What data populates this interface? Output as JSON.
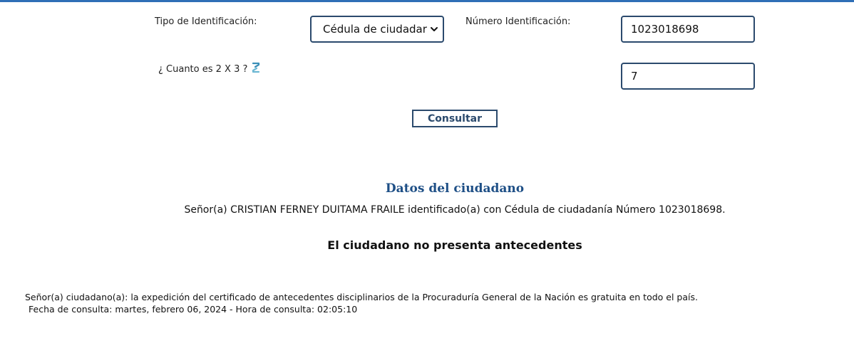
{
  "form": {
    "id_type_label": "Tipo de Identificación:",
    "id_type_value": "Cédula de ciudadar",
    "id_number_label": "Número Identificación:",
    "id_number_value": "1023018698",
    "captcha_label": "¿ Cuanto es 2 X 3 ?",
    "captcha_value": "7",
    "submit_label": "Consultar"
  },
  "result": {
    "title": "Datos del ciudadano",
    "citizen_line": "Señor(a)  CRISTIAN FERNEY DUITAMA FRAILE identificado(a) con Cédula de ciudadanía Número 1023018698.",
    "status": "El ciudadano no presenta antecedentes"
  },
  "footer": {
    "note": "Señor(a) ciudadano(a): la expedición del certificado de antecedentes disciplinarios de la Procuraduría General de la Nación es gratuita en todo el país.",
    "date_line": "Fecha de consulta: martes, febrero 06, 2024 - Hora de consulta: 02:05:10"
  },
  "icons": {
    "refresh": "refresh-icon",
    "dropdown": "chevron-down-icon"
  },
  "colors": {
    "accent_bar": "#2f6fb6",
    "border": "#2b4a6d",
    "title": "#1e4f86"
  }
}
